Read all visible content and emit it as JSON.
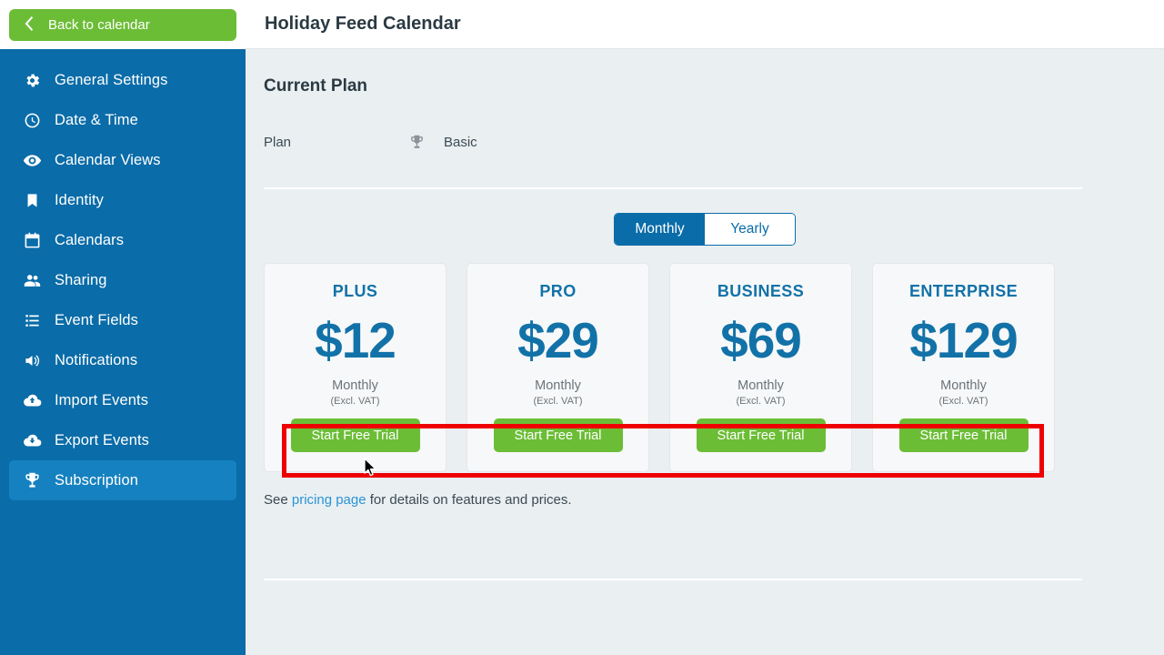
{
  "sidebar": {
    "back_button": {
      "label": "Back to calendar",
      "icon": "chevron-left-icon"
    },
    "items": [
      {
        "label": "General Settings",
        "icon": "gear-icon",
        "active": false
      },
      {
        "label": "Date & Time",
        "icon": "clock-icon",
        "active": false
      },
      {
        "label": "Calendar Views",
        "icon": "eye-icon",
        "active": false
      },
      {
        "label": "Identity",
        "icon": "bookmark-icon",
        "active": false
      },
      {
        "label": "Calendars",
        "icon": "calendar-icon",
        "active": false
      },
      {
        "label": "Sharing",
        "icon": "users-icon",
        "active": false
      },
      {
        "label": "Event Fields",
        "icon": "list-icon",
        "active": false
      },
      {
        "label": "Notifications",
        "icon": "speaker-icon",
        "active": false
      },
      {
        "label": "Import Events",
        "icon": "cloud-upload-icon",
        "active": false
      },
      {
        "label": "Export Events",
        "icon": "cloud-download-icon",
        "active": false
      },
      {
        "label": "Subscription",
        "icon": "trophy-icon",
        "active": true
      }
    ]
  },
  "header": {
    "title": "Holiday Feed Calendar"
  },
  "main": {
    "section_title": "Current Plan",
    "plan_row": {
      "key": "Plan",
      "value": "Basic",
      "icon": "trophy-icon"
    },
    "billing_toggle": {
      "options": [
        {
          "label": "Monthly",
          "selected": true
        },
        {
          "label": "Yearly",
          "selected": false
        }
      ]
    },
    "plans": [
      {
        "name": "PLUS",
        "price": "$12",
        "period": "Monthly",
        "vat": "(Excl. VAT)",
        "cta": "Start Free Trial"
      },
      {
        "name": "PRO",
        "price": "$29",
        "period": "Monthly",
        "vat": "(Excl. VAT)",
        "cta": "Start Free Trial"
      },
      {
        "name": "BUSINESS",
        "price": "$69",
        "period": "Monthly",
        "vat": "(Excl. VAT)",
        "cta": "Start Free Trial"
      },
      {
        "name": "ENTERPRISE",
        "price": "$129",
        "period": "Monthly",
        "vat": "(Excl. VAT)",
        "cta": "Start Free Trial"
      }
    ],
    "footnote": {
      "prefix": "See ",
      "link": "pricing page",
      "suffix": " for details on features and prices."
    }
  },
  "colors": {
    "sidebar_blue": "#0a6ca8",
    "sidebar_active_blue": "#1581c0",
    "green_button": "#6cbd36",
    "accent_blue": "#1272a8",
    "link_blue": "#2a94d6",
    "page_background": "#eaeff2",
    "annotation_red": "#ee0000"
  }
}
